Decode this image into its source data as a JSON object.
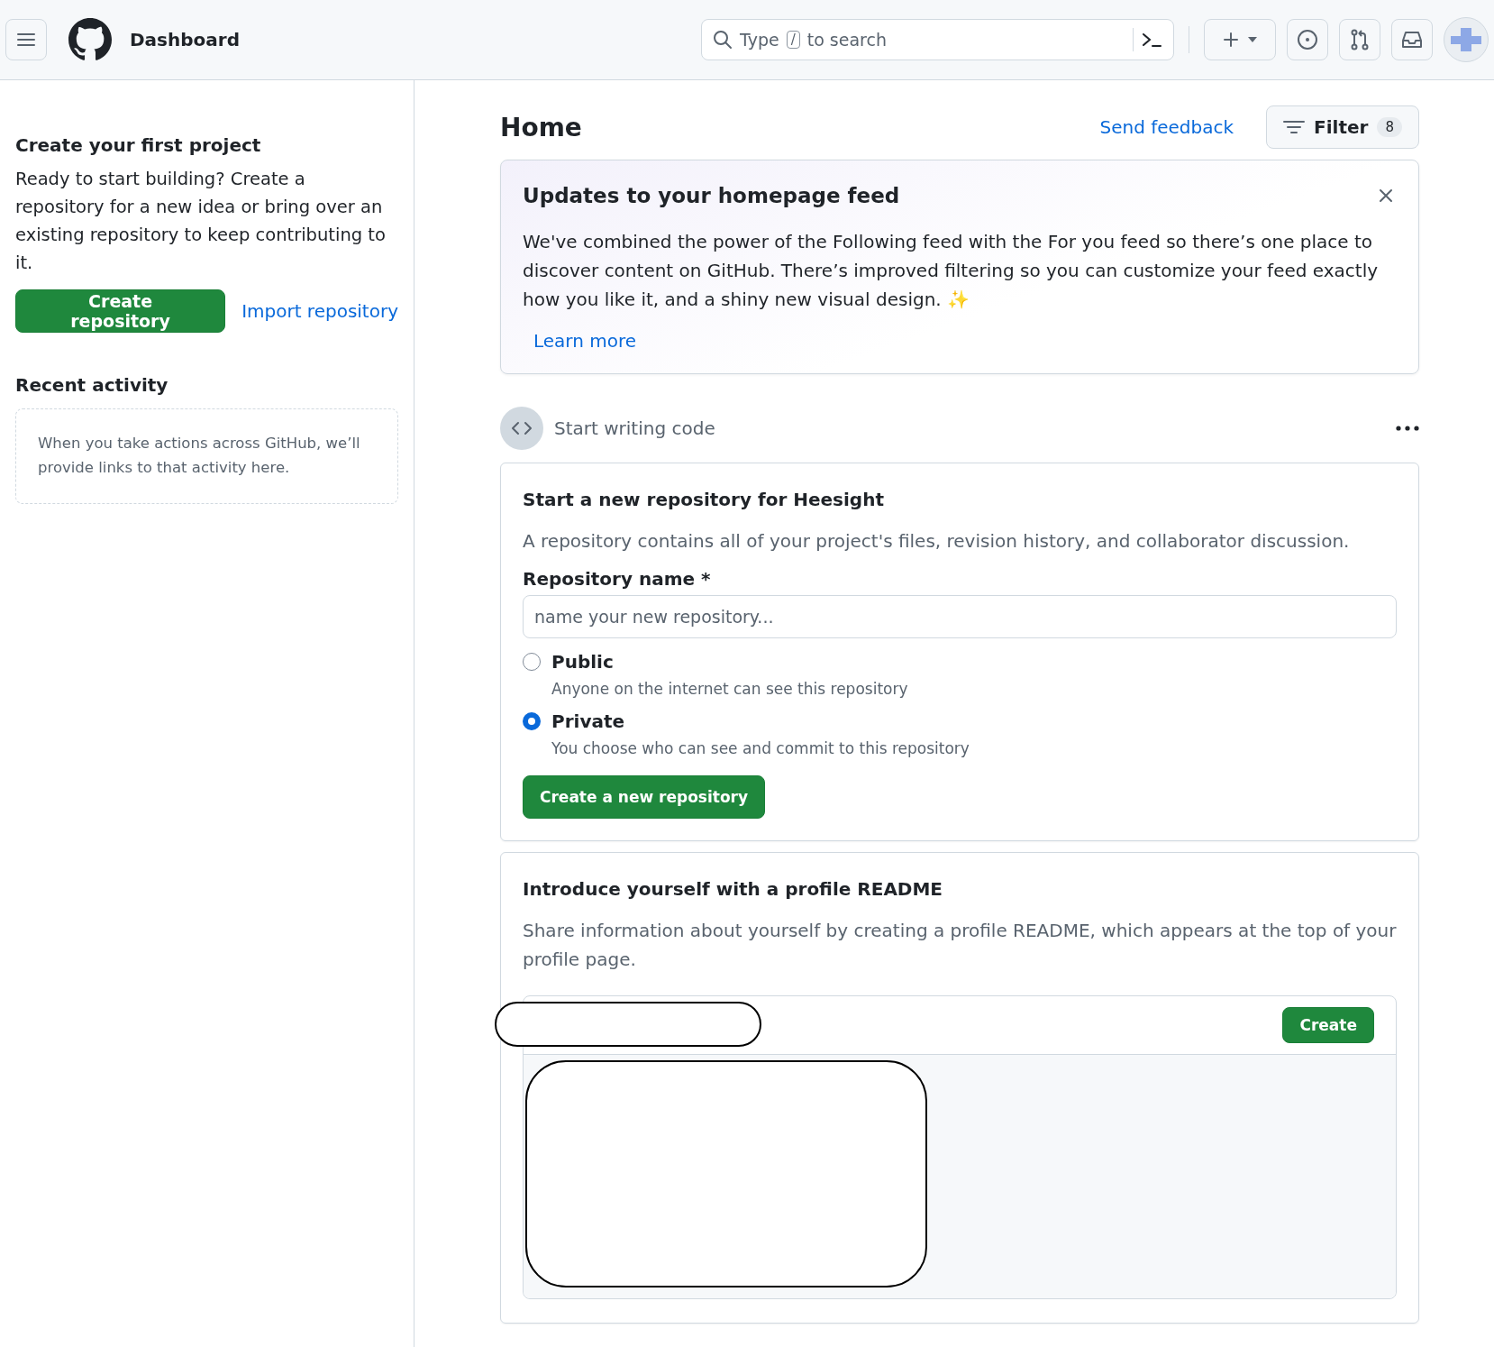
{
  "header": {
    "title": "Dashboard",
    "search": {
      "before_key": "Type",
      "key": "/",
      "after_key": "to search"
    }
  },
  "sidebar": {
    "project_title": "Create your first project",
    "project_text": "Ready to start building? Create a repository for a new idea or bring over an existing repository to keep contributing to it.",
    "create_button": "Create repository",
    "import_link": "Import repository",
    "recent_title": "Recent activity",
    "recent_text": "When you take actions across GitHub, we’ll provide links to that activity here."
  },
  "main": {
    "title": "Home",
    "feedback_link": "Send feedback",
    "filter": {
      "label": "Filter",
      "count": "8"
    },
    "banner": {
      "title": "Updates to your homepage feed",
      "text": "We've combined the power of the Following feed with the For you feed so there’s one place to discover content on GitHub. There’s improved filtering so you can customize your feed exactly how you like it, and a shiny new visual design. ✨",
      "link": "Learn more"
    },
    "section": {
      "title": "Start writing code"
    },
    "new_repo": {
      "title": "Start a new repository for Heesight",
      "text": "A repository contains all of your project's files, revision history, and collaborator discussion.",
      "name_label": "Repository name *",
      "placeholder": "name your new repository...",
      "visibility": [
        {
          "label": "Public",
          "hint": "Anyone on the internet can see this repository",
          "selected": false
        },
        {
          "label": "Private",
          "hint": "You choose who can see and commit to this repository",
          "selected": true
        }
      ],
      "button": "Create a new repository"
    },
    "readme": {
      "title": "Introduce yourself with a profile README",
      "text": "Share information about yourself by creating a profile README, which appears at the top of your profile page.",
      "button": "Create"
    }
  }
}
